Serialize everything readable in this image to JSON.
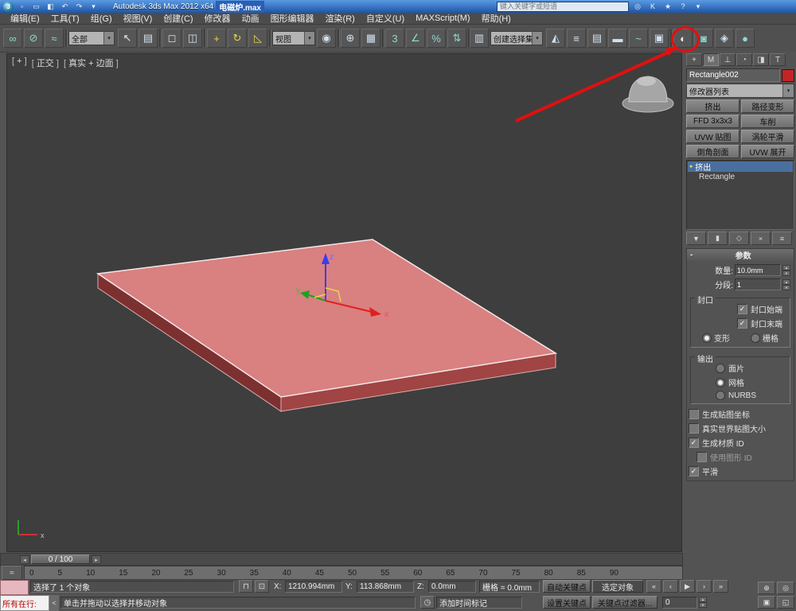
{
  "colors": {
    "annotation": "#e01010",
    "object_fill": "#d98080",
    "object_side_dark": "#7d3030",
    "object_side": "#a04444",
    "selection_highlight": "#4a6f9e",
    "titlebar_blue": "#2a63b8",
    "swatch_red": "#c22525"
  },
  "icons": {
    "logo": "3",
    "new_file": "▫",
    "open_file": "▭",
    "save_file": "◧",
    "undo": "↶",
    "redo": "↷",
    "dropdown": "▾",
    "search": "◎",
    "key": "K",
    "star": "★",
    "help": "?",
    "link": "∞",
    "unlink": "⊘",
    "bind_spacewarp": "≈",
    "select": "↖",
    "select_by_name": "▤",
    "rect_region": "◻",
    "window_crossing": "◫",
    "move": "+",
    "rotate": "↻",
    "scale": "◺",
    "pivot_center": "◉",
    "manipulate": "⊕",
    "keyboard_override": "▦",
    "snap_angle": "∠",
    "snap_percent": "%",
    "snap_spinner": "⇅",
    "named_sets": "▥",
    "mirror": "◭",
    "align": "≡",
    "layers": "▤",
    "ribbon": "▬",
    "curve_editor": "~",
    "schematic": "▣",
    "material_editor": "◐",
    "render_setup": "◙",
    "rendered_frame": "◈",
    "render": "●",
    "tab_create": "+",
    "tab_modify": "M",
    "tab_hierarchy": "⊥",
    "tab_motion": "◔",
    "tab_display": "◨",
    "tab_utilities": "T",
    "pin_stack": "▼",
    "show_end_result": "▮",
    "make_unique": "◇",
    "remove_modifier": "×",
    "configure_sets": "≡",
    "bulb": "●",
    "check": "✓",
    "spin_up": "▲",
    "spin_down": "▼",
    "lock": "⊓",
    "abs_offset": "⊡",
    "time_tag": "◷",
    "mini_curve": "≈",
    "go_start": "«",
    "prev": "‹",
    "play": "▶",
    "next": "›",
    "go_end": "»",
    "pan": "⊕",
    "zoom": "◎",
    "zoom_extents": "▣",
    "maximize_viewport": "◱",
    "chip_left": "◂",
    "chip_right": "▸",
    "listener_handle": "<"
  },
  "titlebar": {
    "app_title": "Autodesk 3ds Max  2012 x64",
    "filename": "电磁炉.max",
    "search_placeholder": "键入关键字或短语"
  },
  "menubar": {
    "items": [
      "编辑(E)",
      "工具(T)",
      "组(G)",
      "视图(V)",
      "创建(C)",
      "修改器",
      "动画",
      "图形编辑器",
      "渲染(R)",
      "自定义(U)",
      "MAXScript(M)",
      "帮助(H)"
    ]
  },
  "toolbar": {
    "selection_filter": "全部",
    "coord_system": "视图",
    "named_selection_set": "创建选择集",
    "snap_3d": "3"
  },
  "viewport": {
    "menu_plus": "+",
    "menu_view": "正交",
    "menu_shading": "真实 + 边面",
    "axis_x": "x",
    "axis_y": "y",
    "axis_z": "z"
  },
  "command_panel": {
    "object_name": "Rectangle002",
    "modifier_list": "修改器列表",
    "modifier_buttons": [
      "挤出",
      "路径变形",
      "FFD 3x3x3",
      "车削",
      "UVW 贴图",
      "涡轮平滑",
      "倒角剖面",
      "UVW 展开"
    ],
    "stack": {
      "item1": "挤出",
      "item2": "Rectangle"
    },
    "params_title": "参数",
    "params_collapse": "-",
    "amount_label": "数量:",
    "amount_value": "10.0mm",
    "segments_label": "分段:",
    "segments_value": "1",
    "cap_group": "封口",
    "cap_start": "封口始端",
    "cap_end": "封口末端",
    "morph": "变形",
    "grid": "栅格",
    "output_group": "输出",
    "patch": "面片",
    "mesh": "网格",
    "nurbs": "NURBS",
    "gen_mapping": "生成贴图坐标",
    "real_world": "真实世界贴图大小",
    "gen_mat_id": "生成材质 ID",
    "use_shape_id": "使用图形 ID",
    "smooth": "平滑"
  },
  "timeline": {
    "slider": "0 / 100",
    "ticks": [
      "0",
      "5",
      "10",
      "15",
      "20",
      "25",
      "30",
      "35",
      "40",
      "45",
      "50",
      "55",
      "60",
      "65",
      "70",
      "75",
      "80",
      "85",
      "90"
    ]
  },
  "statusbar": {
    "selection_status": "选择了 1 个对象",
    "x_label": "X:",
    "x_value": "1210.994mm",
    "y_label": "Y:",
    "y_value": "113.868mm",
    "z_label": "Z:",
    "z_value": "0.0mm",
    "grid_value": "栅格 = 0.0mm",
    "prompt": "单击并拖动以选择并移动对象",
    "time_tag": "添加时间标记",
    "auto_key": "自动关键点",
    "set_key": "设置关键点",
    "selected_filter": "选定对象",
    "key_filters": "关键点过滤器...",
    "mini_listener": "所有在行:",
    "frame_field": "0"
  }
}
